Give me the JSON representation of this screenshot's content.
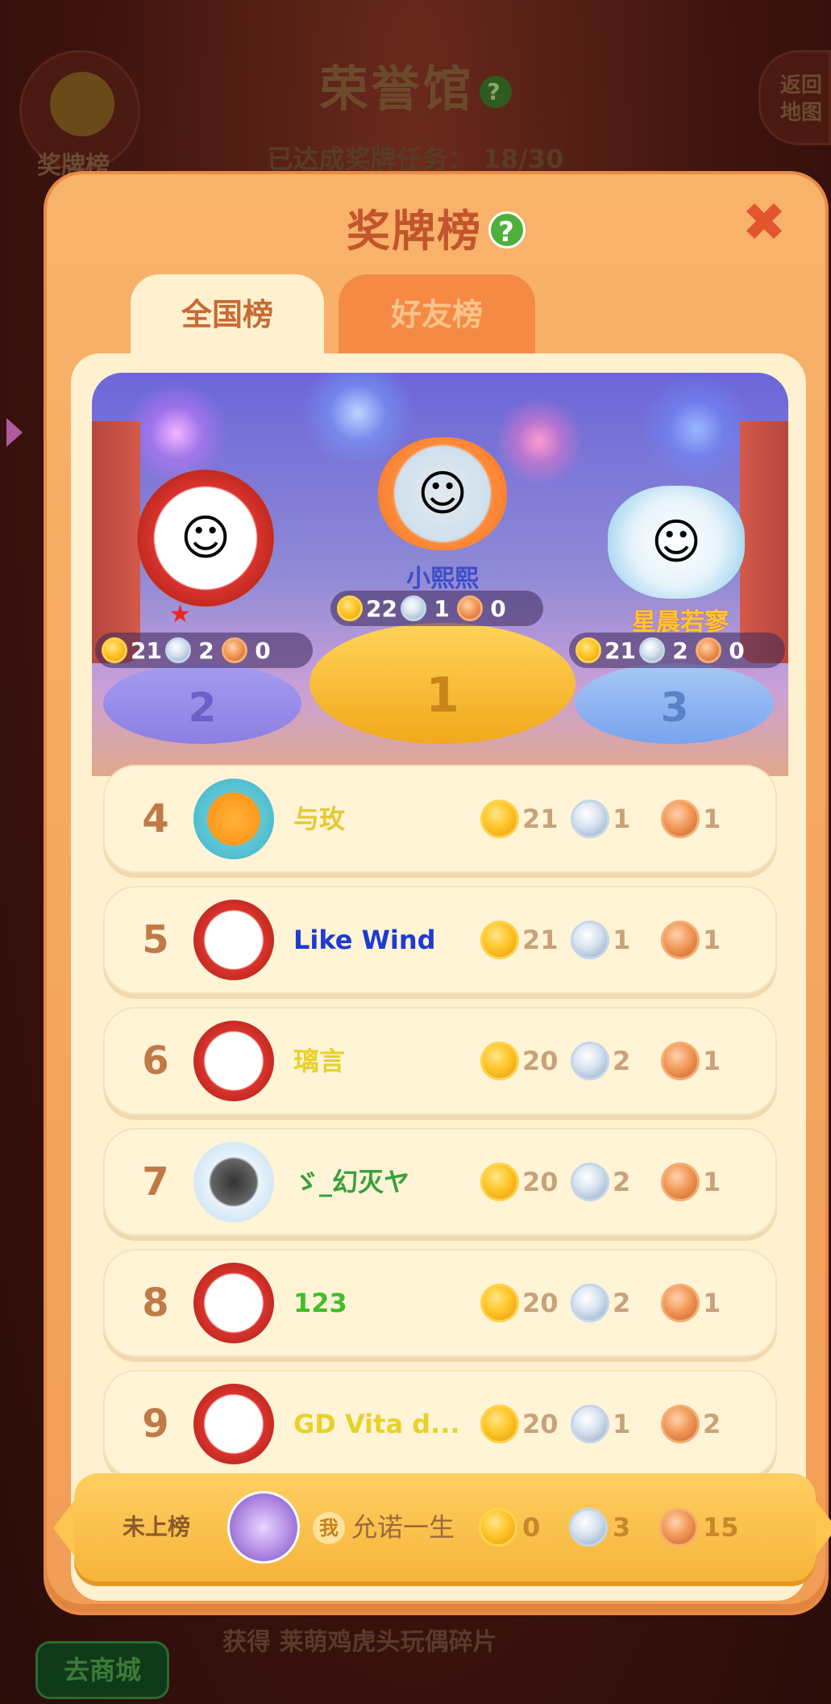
{
  "background": {
    "title": "荣誉馆",
    "progress_label": "已达成奖牌任务：",
    "progress_value": "18/30",
    "medal_board_button": "奖牌榜",
    "back_button": "返回地图",
    "shop_button": "去商城",
    "reward_text": "获得 莱萌鸡虎头玩偶碎片"
  },
  "panel": {
    "title": "奖牌榜",
    "help_icon": "?",
    "close_icon": "✖"
  },
  "tabs": [
    {
      "label": "全国榜",
      "active": true
    },
    {
      "label": "好友榜",
      "active": false
    }
  ],
  "podium": {
    "first": {
      "rank": "1",
      "name": "小熙熙",
      "gold": "22",
      "silver": "1",
      "bronze": "0"
    },
    "second": {
      "rank": "2",
      "name": "",
      "gold": "21",
      "silver": "2",
      "bronze": "0"
    },
    "third": {
      "rank": "3",
      "name": "星晨若寥",
      "gold": "21",
      "silver": "2",
      "bronze": "0"
    }
  },
  "rows": [
    {
      "rank": "4",
      "name": "与玫",
      "name_color": "#e6c832",
      "frame": "cyan",
      "gold": "21",
      "silver": "1",
      "bronze": "1"
    },
    {
      "rank": "5",
      "name": "Like  Wind",
      "name_color": "#1f3ccf",
      "frame": "red",
      "gold": "21",
      "silver": "1",
      "bronze": "1"
    },
    {
      "rank": "6",
      "name": "璃言",
      "name_color": "#e6d22a",
      "frame": "red",
      "gold": "20",
      "silver": "2",
      "bronze": "1"
    },
    {
      "rank": "7",
      "name": "ゞ_幻灭ヤ",
      "name_color": "#3aa03a",
      "frame": "white",
      "gold": "20",
      "silver": "2",
      "bronze": "1"
    },
    {
      "rank": "8",
      "name": "123",
      "name_color": "#3fbf2a",
      "frame": "red",
      "gold": "20",
      "silver": "2",
      "bronze": "1"
    },
    {
      "rank": "9",
      "name": "GD Vita d...",
      "name_color": "#e6d22a",
      "frame": "red",
      "gold": "20",
      "silver": "1",
      "bronze": "2"
    }
  ],
  "me": {
    "status": "未上榜",
    "me_tag": "我",
    "name": "允诺一生",
    "gold": "0",
    "silver": "3",
    "bronze": "15"
  },
  "colors": {
    "panel": "#f8b36a",
    "board": "#fff1cf",
    "rank_text": "#c07a48",
    "close": "#e2552f"
  }
}
